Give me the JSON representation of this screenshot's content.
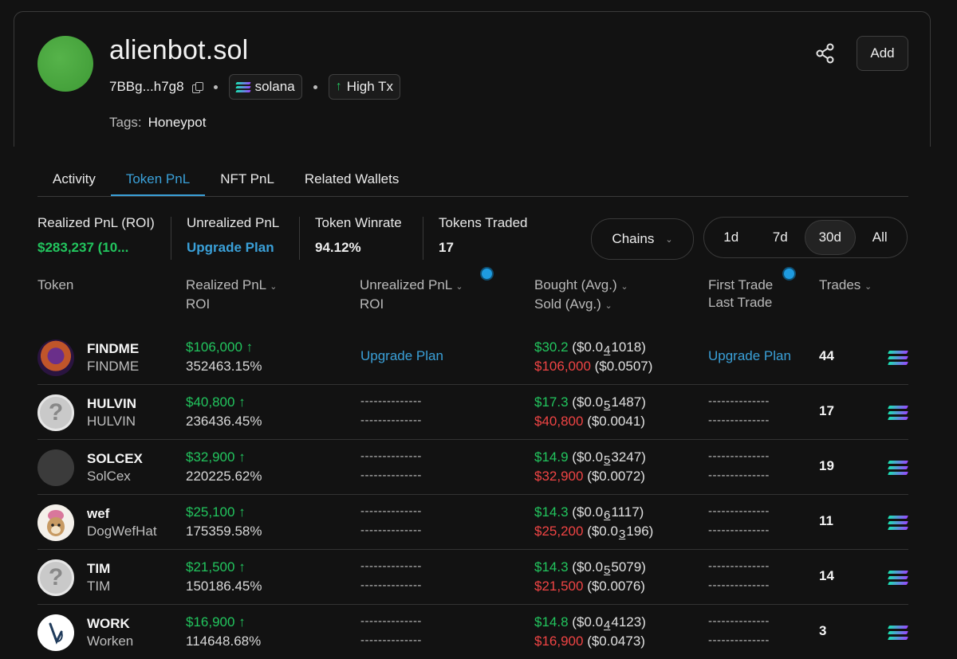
{
  "profile": {
    "name": "alienbot.sol",
    "address": "7BBg...h7g8",
    "chain": "solana",
    "badge": "High Tx",
    "tags_label": "Tags:",
    "tag": "Honeypot",
    "add_label": "Add"
  },
  "tabs": [
    "Activity",
    "Token PnL",
    "NFT PnL",
    "Related Wallets"
  ],
  "active_tab": "Token PnL",
  "stats": {
    "realized_title": "Realized PnL (ROI)",
    "realized_value": "$283,237 (10...",
    "unrealized_title": "Unrealized PnL",
    "unrealized_value": "Upgrade Plan",
    "winrate_title": "Token Winrate",
    "winrate_value": "94.12%",
    "traded_title": "Tokens Traded",
    "traded_value": "17"
  },
  "filters": {
    "chains_label": "Chains",
    "periods": [
      "1d",
      "7d",
      "30d",
      "All"
    ],
    "active_period": "30d"
  },
  "headers": {
    "token": "Token",
    "realized": "Realized PnL",
    "realized_sub": "ROI",
    "unrealized": "Unrealized PnL",
    "unrealized_sub": "ROI",
    "bought": "Bought (Avg.)",
    "sold": "Sold (Avg.)",
    "first_trade": "First Trade",
    "last_trade": "Last Trade",
    "trades": "Trades"
  },
  "placeholder_dashes": "--------------",
  "upgrade_label": "Upgrade Plan",
  "rows": [
    {
      "symbol": "FINDME",
      "name": "FINDME",
      "pnl": "$106,000",
      "roi": "352463.15%",
      "bought": "$30.2",
      "bought_avg": [
        "($0.0",
        "4",
        "1018)"
      ],
      "sold": "$106,000",
      "sold_avg": "($0.0507)",
      "trades": "44",
      "locked": true
    },
    {
      "symbol": "HULVIN",
      "name": "HULVIN",
      "pnl": "$40,800",
      "roi": "236436.45%",
      "bought": "$17.3",
      "bought_avg": [
        "($0.0",
        "5",
        "1487)"
      ],
      "sold": "$40,800",
      "sold_avg": "($0.0041)",
      "trades": "17",
      "locked": false
    },
    {
      "symbol": "SOLCEX",
      "name": "SolCex",
      "pnl": "$32,900",
      "roi": "220225.62%",
      "bought": "$14.9",
      "bought_avg": [
        "($0.0",
        "5",
        "3247)"
      ],
      "sold": "$32,900",
      "sold_avg": "($0.0072)",
      "trades": "19",
      "locked": false
    },
    {
      "symbol": "wef",
      "name": "DogWefHat",
      "pnl": "$25,100",
      "roi": "175359.58%",
      "bought": "$14.3",
      "bought_avg": [
        "($0.0",
        "6",
        "1117)"
      ],
      "sold": "$25,200",
      "sold_avg_parts": [
        "($0.0",
        "3",
        "196)"
      ],
      "trades": "11",
      "locked": false
    },
    {
      "symbol": "TIM",
      "name": "TIM",
      "pnl": "$21,500",
      "roi": "150186.45%",
      "bought": "$14.3",
      "bought_avg": [
        "($0.0",
        "5",
        "5079)"
      ],
      "sold": "$21,500",
      "sold_avg": "($0.0076)",
      "trades": "14",
      "locked": false
    },
    {
      "symbol": "WORK",
      "name": "Worken",
      "pnl": "$16,900",
      "roi": "114648.68%",
      "bought": "$14.8",
      "bought_avg": [
        "($0.0",
        "4",
        "4123)"
      ],
      "sold": "$16,900",
      "sold_avg": "($0.0473)",
      "trades": "3",
      "locked": false
    }
  ],
  "colors": {
    "positive": "#22c55e",
    "negative": "#ef4444",
    "accent": "#3aa0d8"
  },
  "icons": {
    "share": "share-icon",
    "copy": "copy-icon",
    "chain": "solana-icon",
    "trend": "arrow-up-icon"
  }
}
